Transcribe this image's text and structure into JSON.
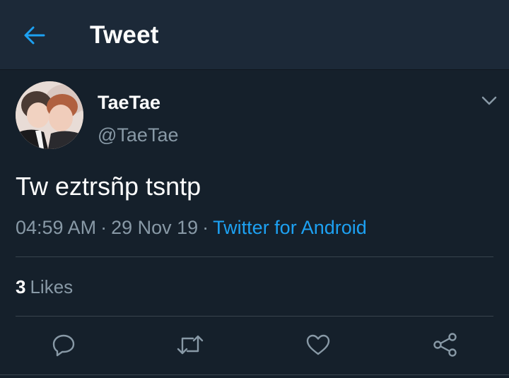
{
  "header": {
    "title": "Tweet",
    "back_icon": "arrow-left-icon"
  },
  "tweet": {
    "author_name": "TaeTae",
    "author_handle": "@TaeTae",
    "menu_icon": "chevron-down-icon",
    "text": "Tw eztrsñp tsntp",
    "time": "04:59 AM",
    "separator": "·",
    "date": "29 Nov 19",
    "source": "Twitter for Android",
    "likes_count": "3",
    "likes_label": "Likes"
  },
  "actions": [
    {
      "icon": "reply-icon"
    },
    {
      "icon": "retweet-icon"
    },
    {
      "icon": "like-icon"
    },
    {
      "icon": "share-icon"
    }
  ],
  "colors": {
    "background": "#15202b",
    "header_background": "#1c2938",
    "accent": "#1da1f2",
    "secondary_text": "#8899a6",
    "divider": "#38444d"
  }
}
